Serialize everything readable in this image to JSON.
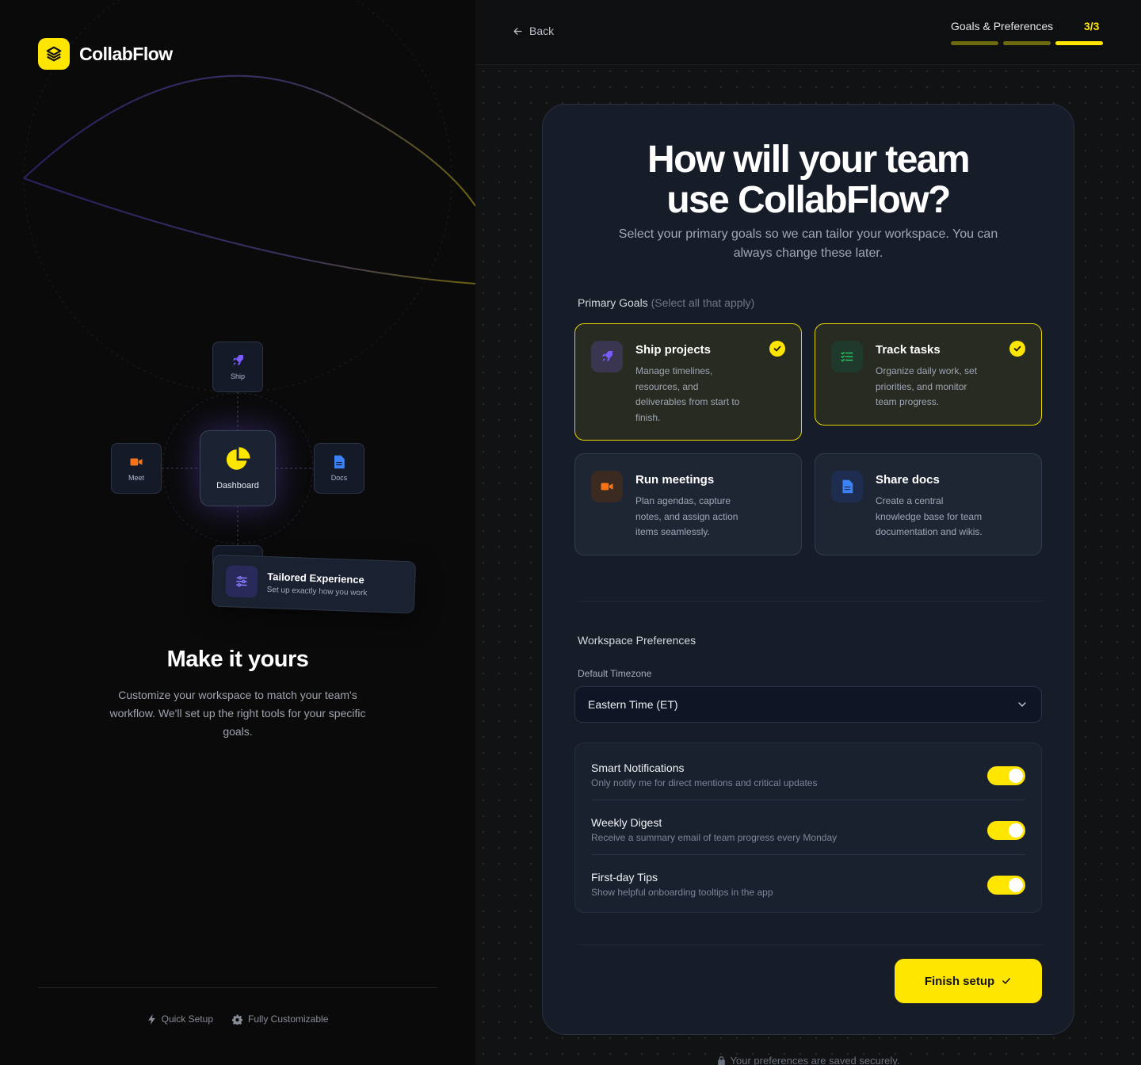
{
  "brand": {
    "name": "CollabFlow"
  },
  "illustration": {
    "nodes": {
      "ship": "Ship",
      "meet": "Meet",
      "dashboard": "Dashboard",
      "docs": "Docs"
    },
    "tailored": {
      "title": "Tailored Experience",
      "subtitle": "Set up exactly how you work"
    }
  },
  "left": {
    "title": "Make it yours",
    "description": "Customize your workspace to match your team's workflow. We'll set up the right tools for your specific goals.",
    "features": [
      "Quick Setup",
      "Fully Customizable"
    ]
  },
  "header": {
    "back": "Back",
    "step_label": "Goals & Preferences",
    "step_count": "3/3",
    "steps_total": 3,
    "steps_completed": 3
  },
  "main": {
    "title_line1": "How will your team",
    "title_line2": "use CollabFlow?",
    "subtitle": "Select your primary goals so we can tailor your workspace. You can always change these later.",
    "goals_label": "Primary Goals",
    "goals_hint": "(Select all that apply)",
    "goals": [
      {
        "title": "Ship projects",
        "description": "Manage timelines, resources, and deliverables from start to finish.",
        "icon": "rocket-icon",
        "selected": true,
        "color": "#7c5cff"
      },
      {
        "title": "Track tasks",
        "description": "Organize daily work, set priorities, and monitor team progress.",
        "icon": "checklist-icon",
        "selected": true,
        "color": "#22c55e"
      },
      {
        "title": "Run meetings",
        "description": "Plan agendas, capture notes, and assign action items seamlessly.",
        "icon": "video-icon",
        "selected": false,
        "color": "#f97316"
      },
      {
        "title": "Share docs",
        "description": "Create a central knowledge base for team documentation and wikis.",
        "icon": "document-icon",
        "selected": false,
        "color": "#3b82f6"
      }
    ],
    "prefs_title": "Workspace Preferences",
    "timezone_label": "Default Timezone",
    "timezone_value": "Eastern Time (ET)",
    "toggles": [
      {
        "title": "Smart Notifications",
        "description": "Only notify me for direct mentions and critical updates",
        "on": true
      },
      {
        "title": "Weekly Digest",
        "description": "Receive a summary email of team progress every Monday",
        "on": true
      },
      {
        "title": "First-day Tips",
        "description": "Show helpful onboarding tooltips in the app",
        "on": true
      }
    ],
    "finish": "Finish setup"
  },
  "footer": {
    "secure": "Your preferences are saved securely."
  },
  "colors": {
    "accent": "#ffe600",
    "card": "#171d28",
    "background": "#111214"
  }
}
